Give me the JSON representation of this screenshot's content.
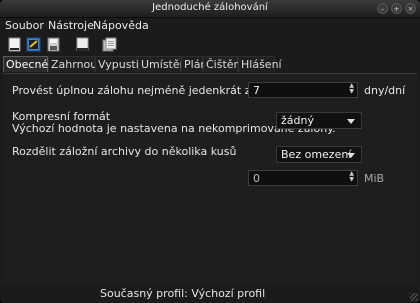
{
  "window": {
    "title": "Jednoduché zálohování",
    "buttons": {
      "minimize": "–",
      "maximize": "+",
      "close": "×"
    }
  },
  "menubar": {
    "items": [
      {
        "label": "Soubor"
      },
      {
        "label": "Nástroje"
      },
      {
        "label": "Nápověda"
      }
    ]
  },
  "toolbar": {
    "icons": [
      "new-profile-icon",
      "settings-icon",
      "save-icon",
      "backup-now-icon",
      "restore-icon"
    ]
  },
  "tabs": [
    {
      "label": "Obecné",
      "active": true
    },
    {
      "label": "Zahrnout"
    },
    {
      "label": "Vypustit"
    },
    {
      "label": "Umístění"
    },
    {
      "label": "Plán"
    },
    {
      "label": "Čištění"
    },
    {
      "label": "Hlášení"
    }
  ],
  "general": {
    "full_backup_label": "Provést úplnou zálohu nejméně jedenkrát za",
    "full_backup_value": "7",
    "full_backup_unit": "dny/dní",
    "compression_label": "Kompresní formát",
    "compression_note": "Výchozí hodnota je nastavena na nekomprimované zálohy.",
    "compression_value": "žádný",
    "split_label": "Rozdělit záložní archivy do několika kusů",
    "split_value": "Bez omezení",
    "split_size_value": "0",
    "split_size_unit": "MiB"
  },
  "status": {
    "text": "Současný profil: Výchozí profil"
  }
}
